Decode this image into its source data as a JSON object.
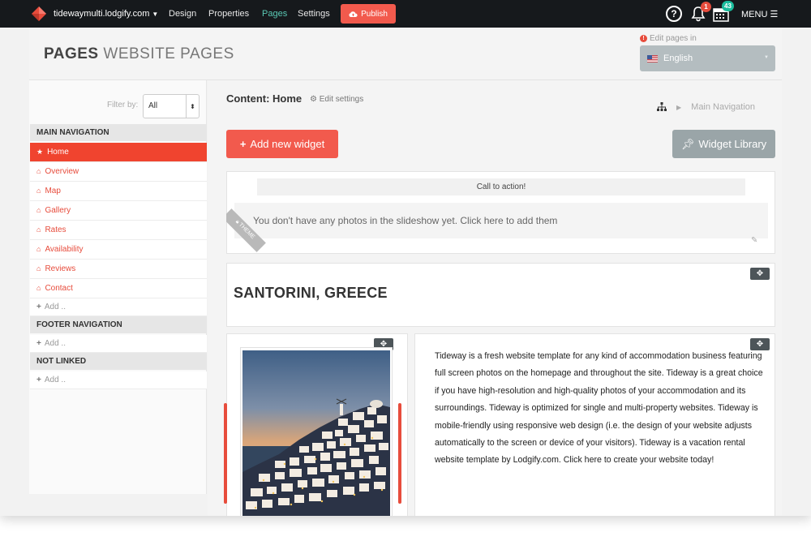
{
  "topbar": {
    "site": "tidewaymulti.lodgify.com",
    "nav": [
      "Design",
      "Properties",
      "Pages",
      "Settings"
    ],
    "active_nav": "Pages",
    "publish": "Publish",
    "notifications_count": "1",
    "calendar_count": "43",
    "menu": "MENU",
    "colors": {
      "bar": "#16191c",
      "accent": "#f25a4d",
      "active": "#5ac8b4"
    }
  },
  "header": {
    "title_bold": "PAGES",
    "title_light": "WEBSITE PAGES",
    "edit_in_label": "Edit pages in",
    "language": "English"
  },
  "sidebar": {
    "filter_label": "Filter by:",
    "filter_value": "All",
    "main_nav_heading": "MAIN NAVIGATION",
    "main_nav_items": [
      "Home",
      "Overview",
      "Map",
      "Gallery",
      "Rates",
      "Availability",
      "Reviews",
      "Contact"
    ],
    "add_label": "Add ..",
    "footer_nav_heading": "FOOTER NAVIGATION",
    "not_linked_heading": "NOT LINKED"
  },
  "main": {
    "content_title": "Content: Home",
    "edit_settings": "Edit settings",
    "breadcrumb": "Main Navigation",
    "add_widget": "Add new widget",
    "widget_library": "Widget Library",
    "cta_label": "Call to action!",
    "slideshow_empty": "You don't have any photos in the slideshow yet. Click here to add them",
    "theme_ribbon": "THEME",
    "heading": "SANTORINI, GREECE",
    "body_text": "Tideway is a fresh website template for any kind of accommodation business featuring full screen photos on the homepage and throughout the site. Tideway is a great choice if you have high-resolution and high-quality photos of your accommodation and its surroundings. Tideway is optimized for single and multi-property websites. Tideway is mobile-friendly using responsive web design (i.e. the design of your website adjusts automatically to the screen or device of your visitors). Tideway is a vacation rental website template by Lodgify.com. Click here to create your website today!"
  }
}
